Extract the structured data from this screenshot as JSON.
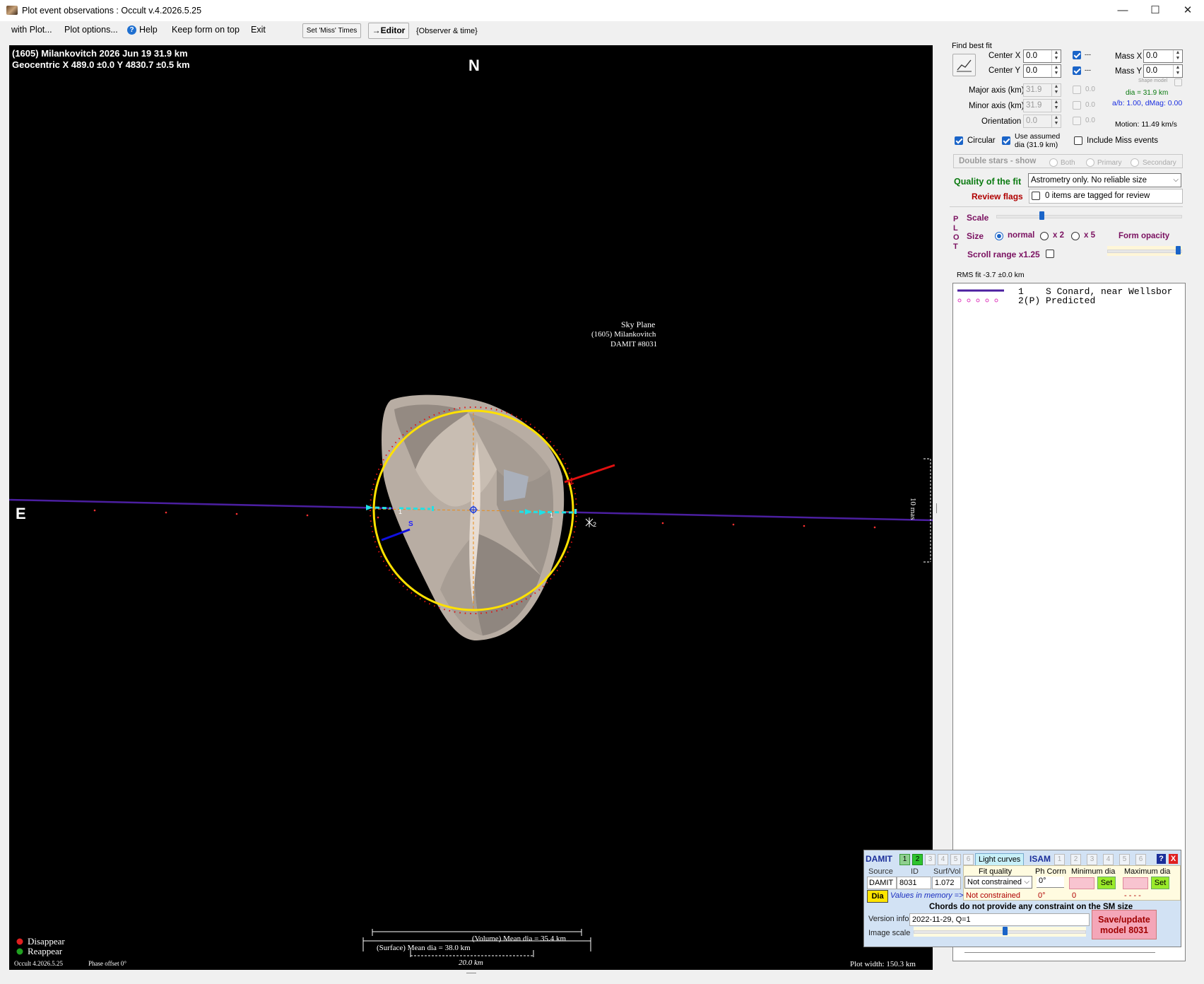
{
  "window": {
    "title": "Plot event observations : Occult v.4.2026.5.25",
    "minimize": "—",
    "maximize": "☐",
    "close": "✕"
  },
  "menu": {
    "with_plot": "with Plot...",
    "plot_options": "Plot options...",
    "help": "Help",
    "keep_form_on_top": "Keep form on top",
    "exit": "Exit",
    "set_miss_times": "Set 'Miss' Times",
    "editor": "→Editor",
    "observer_time": "{Observer & time}"
  },
  "plot": {
    "header_line1": "(1605) Milankovitch  2026 Jun 19   31.9 km",
    "header_line2": "Geocentric  X  489.0 ±0.0  Y 4830.7 ±0.5 km",
    "north": "N",
    "east": "E",
    "sky_plane": "Sky Plane",
    "sky_asteroid": "(1605) Milankovitch",
    "sky_damit": "DAMIT #8031",
    "scale_mas": "10 mas",
    "pole_n": "N",
    "pole_s": "S",
    "chord_label_1a": "1",
    "chord_label_1b": "1",
    "chord_label_2": "2",
    "volume_mean_dia": "(Volume) Mean dia = 35.4 km",
    "surface_mean_dia": "(Surface) Mean dia = 38.0 km",
    "scale_km": "20.0 km",
    "disappear": "Disappear",
    "reappear": "Reappear",
    "version": "Occult 4.2026.5.25",
    "phase_offset": "Phase offset 0°",
    "plot_width": "Plot width: 150.3 km"
  },
  "fit": {
    "find_best_fit": "Find best fit",
    "center_x_label": "Center X",
    "center_x": "0.0",
    "center_y_label": "Center Y",
    "center_y": "0.0",
    "dash1": "---",
    "dash2": "---",
    "mass_x_label": "Mass X",
    "mass_x": "0.0",
    "mass_y_label": "Mass Y",
    "mass_y": "0.0",
    "shape_model": "Shape model",
    "major_axis_label": "Major axis (km)",
    "major_axis": "31.9",
    "minor_axis_label": "Minor axis (km)",
    "minor_axis": "31.9",
    "orientation_label": "Orientation",
    "orientation": "0.0",
    "unc1": "0.0",
    "unc2": "0.0",
    "unc3": "0.0",
    "dia_info": "dia = 31.9 km",
    "ab_info": "a/b: 1.00, dMag: 0.00",
    "motion": "Motion: 11.49 km/s",
    "circular": "Circular",
    "use_assumed": "Use assumed",
    "use_assumed2": "dia (31.9 km)",
    "include_miss": "Include Miss events",
    "double_stars": "Double stars - show",
    "both": "Both",
    "primary": "Primary",
    "secondary": "Secondary",
    "quality_label": "Quality of the fit",
    "quality_value": "Astrometry only. No reliable size",
    "review_label": "Review flags",
    "review_value": "0 items are tagged for review"
  },
  "plotctl": {
    "plot_vertical": [
      "P",
      "L",
      "O",
      "T"
    ],
    "scale": "Scale",
    "size": "Size",
    "normal": "normal",
    "x2": "x 2",
    "x5": "x 5",
    "form_opacity": "Form opacity",
    "scroll_range": "Scroll range x1.25",
    "rms": "RMS fit -3.7 ±0.0 km",
    "scale_level": 0.24,
    "opacity_level": 0.98
  },
  "legend": [
    {
      "num": "1",
      "text": "S Conard, near Wellsbor"
    },
    {
      "num": "2(P)",
      "text": "Predicted"
    }
  ],
  "damit": {
    "damit_label": "DAMIT",
    "tabs_damit": [
      "1",
      "2",
      "3",
      "4",
      "5",
      "6"
    ],
    "light_curves": "Light curves",
    "isam_label": "ISAM",
    "tabs_isam": [
      "1",
      "2",
      "3",
      "4",
      "5",
      "6"
    ],
    "help": "?",
    "close": "X",
    "source_hdr": "Source",
    "id_hdr": "ID",
    "surfvol_hdr": "Surf/Vol",
    "fitq_hdr": "Fit quality",
    "phcorr_hdr": "Ph Corrn",
    "mindia_hdr": "Minimum dia",
    "maxdia_hdr": "Maximum dia",
    "source": "DAMIT",
    "id": "8031",
    "surfvol": "1.072",
    "fit_quality": "Not constrained",
    "phcorr": "0°",
    "set1": "Set",
    "set2": "Set",
    "dia_btn": "Dia",
    "values_in_memory": "Values in memory =>",
    "mem_fit": "Not constrained",
    "mem_ph": "0°",
    "mem_min": "0",
    "mem_max": "- - - -",
    "chords_note": "Chords do not provide any constraint on the SM size",
    "version_label": "Version info",
    "version": "2022-11-29, Q=1",
    "image_scale_label": "Image scale",
    "image_scale_level": 0.53,
    "save_update": "Save/update",
    "model": "model 8031"
  },
  "colors": {
    "plot_bg": "#000000",
    "chord_path": "#4b1fa0",
    "limb": "#ffe100",
    "cyan": "#21e0e6",
    "pole_n": "#e01010",
    "pole_s": "#1010e0",
    "quality_green": "#0a7a10",
    "review_red": "#b00000",
    "plot_purple": "#7a1060",
    "save_pink": "#f4a6b8"
  }
}
